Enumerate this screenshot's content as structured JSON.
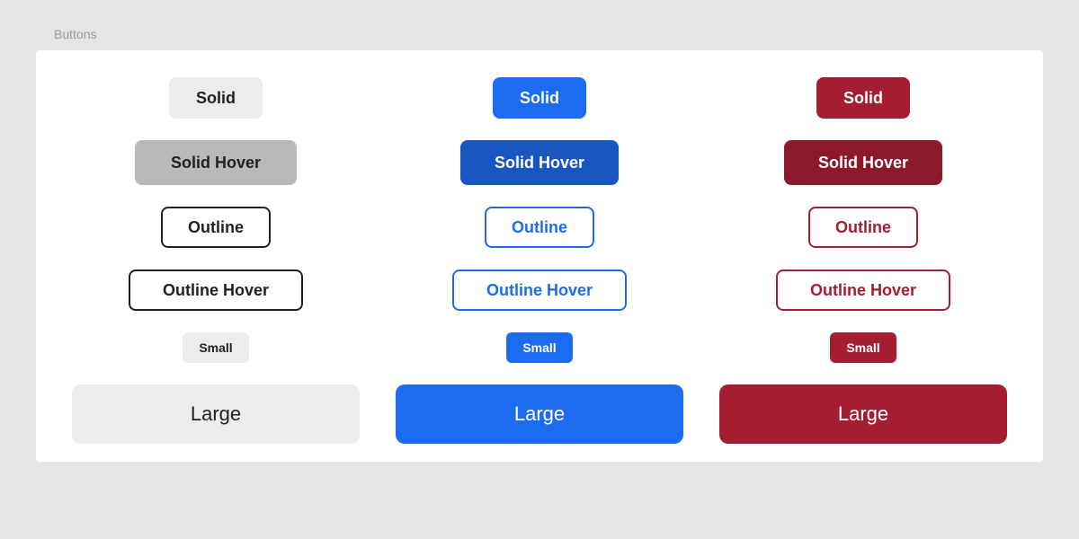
{
  "section_title": "Buttons",
  "labels": {
    "solid": "Solid",
    "solid_hover": "Solid Hover",
    "outline": "Outline",
    "outline_hover": "Outline Hover",
    "small": "Small",
    "large": "Large"
  },
  "colors": {
    "default_solid": "#ececec",
    "default_solid_hover": "#b9b9b9",
    "default_text": "#222222",
    "primary": "#1c6cf2",
    "primary_hover": "#1956c2",
    "danger": "#a51d30",
    "danger_hover": "#8d1a2a"
  }
}
